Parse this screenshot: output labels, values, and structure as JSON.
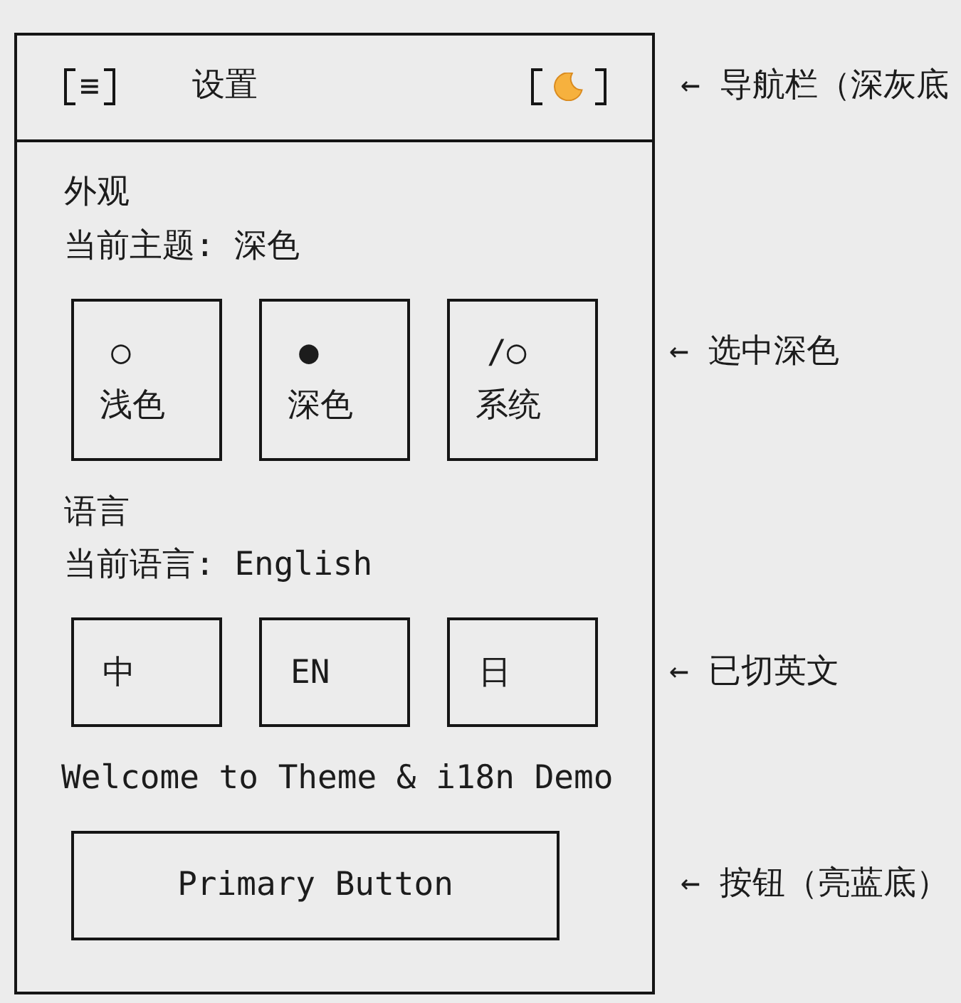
{
  "navbar": {
    "menu_button": {
      "label": "≡"
    },
    "title": "设置",
    "annotation": "← 导航栏（深灰底"
  },
  "appearance": {
    "heading": "外观",
    "current": "当前主题: 深色",
    "options": [
      {
        "symbol": "○",
        "label": "浅色"
      },
      {
        "symbol": "●",
        "label": "深色"
      },
      {
        "symbol": "/○",
        "label": "系统"
      }
    ],
    "annotation": "← 选中深色"
  },
  "language": {
    "heading": "语言",
    "current": "当前语言: English",
    "options": [
      {
        "label": "中"
      },
      {
        "label": "EN"
      },
      {
        "label": "日"
      }
    ],
    "annotation": "← 已切英文"
  },
  "welcome": "Welcome to Theme & i18n Demo",
  "primary_button": {
    "label": "Primary Button",
    "annotation": "← 按钮（亮蓝底）"
  }
}
